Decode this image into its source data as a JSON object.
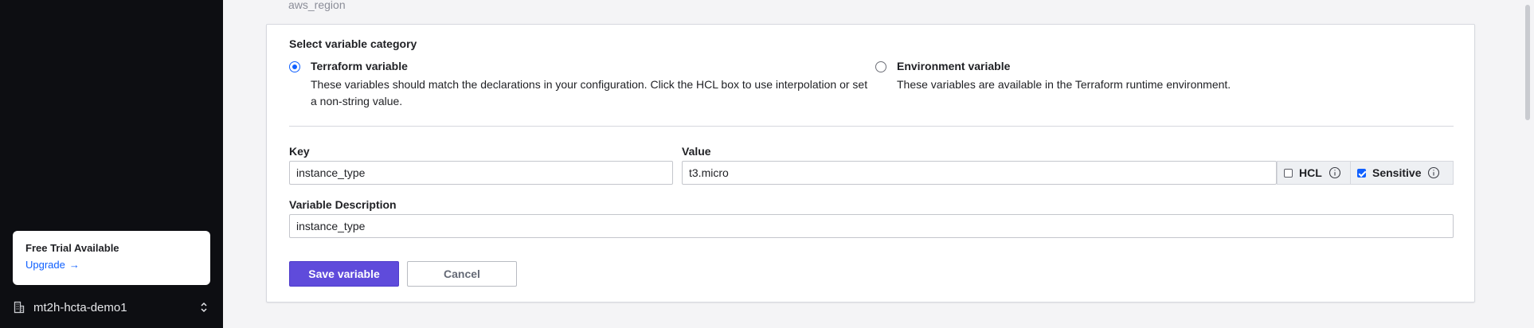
{
  "sidebar": {
    "trial_card": {
      "title": "Free Trial Available",
      "link_label": "Upgrade",
      "link_arrow": "→"
    },
    "org_switcher": {
      "name": "mt2h-hcta-demo1",
      "icon": "building-icon",
      "toggle_icon": "chevron-up-down-icon"
    }
  },
  "main": {
    "previous_variable": "aws_region",
    "form": {
      "category_heading": "Select variable category",
      "options": [
        {
          "label": "Terraform variable",
          "description": "These variables should match the declarations in your configuration. Click the HCL box to use interpolation or set a non-string value.",
          "selected": true
        },
        {
          "label": "Environment variable",
          "description": "These variables are available in the Terraform runtime environment.",
          "selected": false
        }
      ],
      "key": {
        "label": "Key",
        "value": "instance_type"
      },
      "value": {
        "label": "Value",
        "value": "t3.micro"
      },
      "hcl": {
        "label": "HCL",
        "checked": false
      },
      "sensitive": {
        "label": "Sensitive",
        "checked": true
      },
      "description": {
        "label": "Variable Description",
        "value": "instance_type"
      },
      "save_label": "Save variable",
      "cancel_label": "Cancel"
    }
  },
  "colors": {
    "accent": "#1060ff",
    "primary_button": "#5f4bdb",
    "sidebar_bg": "#0d0e12"
  }
}
